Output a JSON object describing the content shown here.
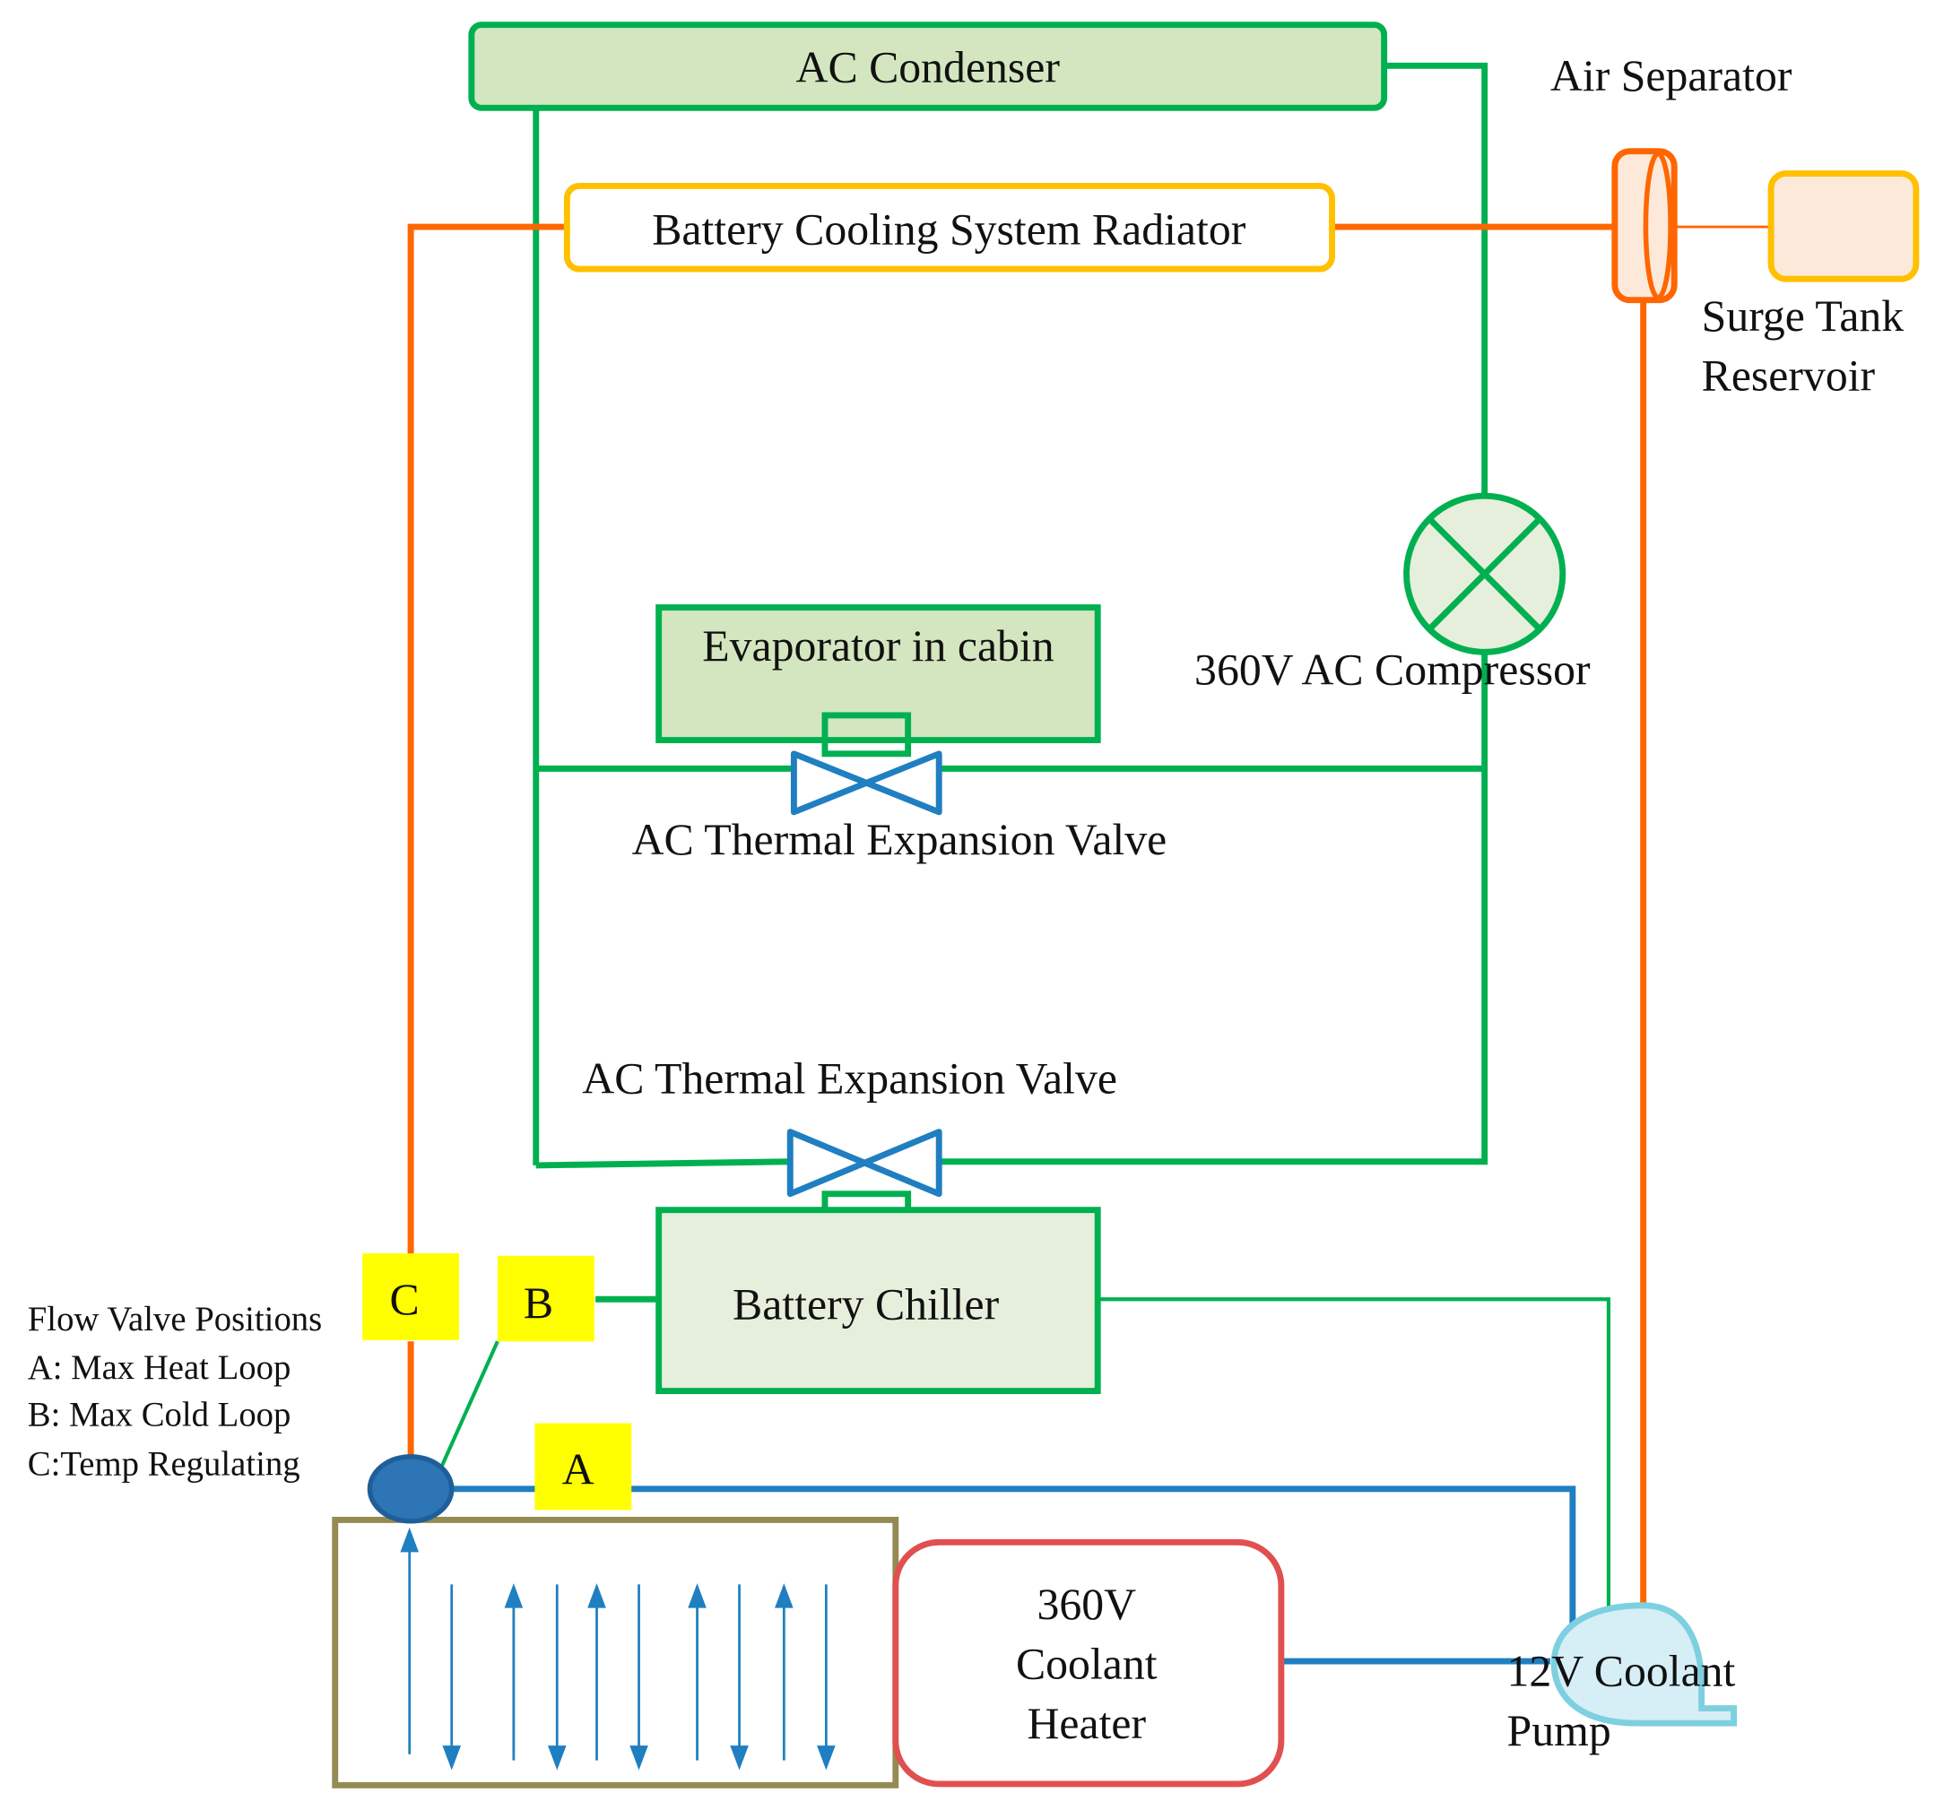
{
  "components": {
    "ac_condenser": "AC Condenser",
    "radiator": "Battery Cooling System Radiator",
    "air_separator": "Air Separator",
    "surge_tank_line1": "Surge Tank",
    "surge_tank_line2": "Reservoir",
    "compressor": "360V AC Compressor",
    "evaporator": "Evaporator in cabin",
    "expansion_valve_upper": "AC Thermal Expansion Valve",
    "expansion_valve_lower": "AC Thermal Expansion Valve",
    "battery_chiller": "Battery Chiller",
    "heater_line1": "360V",
    "heater_line2": "Coolant",
    "heater_line3": "Heater",
    "pump_line1": "12V Coolant",
    "pump_line2": "Pump"
  },
  "valve_markers": {
    "a": "A",
    "b": "B",
    "c": "C"
  },
  "legend": {
    "title": "Flow Valve Positions",
    "items": [
      "A: Max Heat Loop",
      "B: Max Cold Loop",
      "C:Temp Regulating"
    ]
  },
  "colors": {
    "refrigerant_line": "#00b050",
    "coolant_hot_line": "#ff6600",
    "coolant_line": "#1f7fc0",
    "marker_fill": "#ffff00",
    "radiator_border": "#ffc000",
    "heater_border": "#e05050",
    "battery_border": "#948a54"
  }
}
